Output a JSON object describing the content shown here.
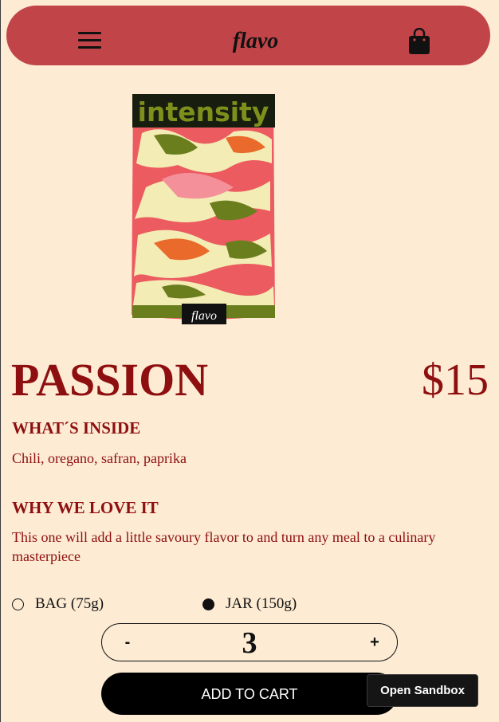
{
  "header": {
    "brand": "flavo",
    "menu_icon": "hamburger-menu-icon",
    "cart_icon": "shopping-bag-icon"
  },
  "product": {
    "image_label": "intensity",
    "image_brand": "flavo",
    "title": "PASSION",
    "price": "$15",
    "whats_inside_heading": "WHAT´S INSIDE",
    "whats_inside_text": "Chili, oregano, safran, paprika",
    "why_heading": "WHY WE LOVE IT",
    "why_text": "This one will add a little savoury flavor to and turn any meal to a culinary masterpiece"
  },
  "sizes": [
    {
      "label": "BAG (75g)",
      "selected": false
    },
    {
      "label": "JAR (150g)",
      "selected": true
    }
  ],
  "quantity": {
    "minus_label": "-",
    "value": "3",
    "plus_label": "+"
  },
  "add_to_cart_label": "ADD TO CART",
  "sandbox_label": "Open Sandbox",
  "colors": {
    "background": "#fdebd3",
    "nav": "#c14548",
    "accent_text": "#8e0f10"
  }
}
